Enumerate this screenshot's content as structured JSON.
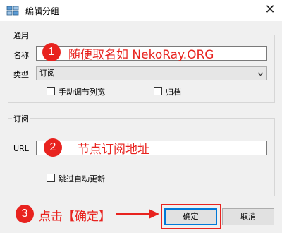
{
  "window": {
    "title": "编辑分组",
    "close_glyph": "✕",
    "icon": "folder-group-icon"
  },
  "general": {
    "legend": "通用",
    "name_label": "名称",
    "name_value": "",
    "type_label": "类型",
    "type_value": "订阅",
    "manual_columns_label": "手动调节列宽",
    "archive_label": "归档"
  },
  "subscription": {
    "legend": "订阅",
    "url_label": "URL",
    "url_value": "",
    "skip_update_label": "跳过自动更新"
  },
  "buttons": {
    "ok_label": "确定",
    "cancel_label": "取消"
  },
  "annotations": {
    "color": "#e8231f",
    "step1_number": "1",
    "step1_text": "随便取名如 NekoRay.ORG",
    "step2_number": "2",
    "step2_text": "节点订阅地址",
    "step3_number": "3",
    "step3_text": "点击【确定】"
  }
}
